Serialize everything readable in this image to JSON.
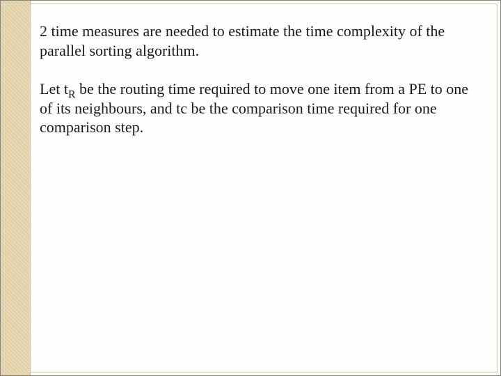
{
  "slide": {
    "paragraphs": {
      "p1": "2 time measures are needed to estimate the time complexity of the parallel sorting algorithm.",
      "p2a": "Let t",
      "p2sub": "R",
      "p2b": " be the routing time required to move one item from a PE to one of its neighbours, and tc be the comparison time required for one comparison step."
    }
  }
}
